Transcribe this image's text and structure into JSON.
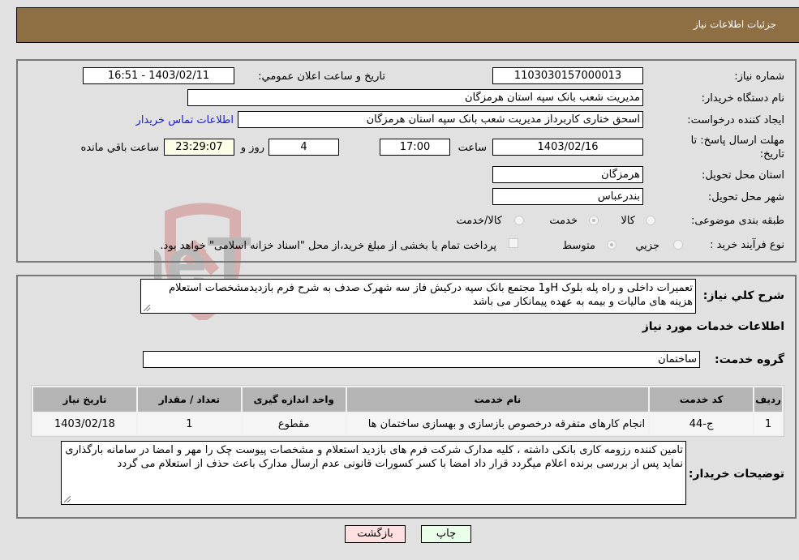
{
  "header": {
    "title": "جزئیات اطلاعات نیاز"
  },
  "form": {
    "need_number": {
      "label": "شماره نیاز:",
      "value": "1103030157000013"
    },
    "announce_datetime": {
      "label": "تاریخ و ساعت اعلان عمومي:",
      "value": "1403/02/11 - 16:51"
    },
    "buyer_org": {
      "label": "نام دستگاه خریدار:",
      "value": "مدیریت شعب بانک سپه استان هرمزگان"
    },
    "requester": {
      "label": "ایجاد کننده درخواست:",
      "value": "اسحق ختاری کاربرداز مدیریت شعب بانک سپه استان هرمزگان"
    },
    "buyer_contact_link": "اطلاعات تماس خریدار",
    "deadline": {
      "label_line1": "مهلت ارسال پاسخ: تا",
      "label_line2": "تاریخ:",
      "date": "1403/02/16",
      "time_label": "ساعت",
      "time": "17:00",
      "days": "4",
      "days_label": "روز و",
      "remaining": "23:29:07",
      "remaining_label": "ساعت باقي مانده"
    },
    "province": {
      "label": "استان محل تحویل:",
      "value": "هرمزگان"
    },
    "city": {
      "label": "شهر محل تحویل:",
      "value": "بندرعباس"
    },
    "category": {
      "label": "طبقه بندی موضوعی:",
      "options": [
        "کالا",
        "خدمت",
        "کالا/خدمت"
      ],
      "selected": "خدمت"
    },
    "purchase_type": {
      "label": "نوع فرآیند خرید :",
      "options": [
        "جزيي",
        "متوسط"
      ],
      "selected": "متوسط",
      "treasury_note": "پرداخت تمام یا بخشی از مبلغ خرید،از محل \"اسناد خزانه اسلامی\" خواهد بود."
    }
  },
  "description": {
    "label": "شرح كلي نياز:",
    "text": "تعمیرات داخلی و راه پله بلوک Hو1 مجتمع بانک سپه درکیش فاز سه شهرک صدف به شرح فرم بازدیدمشخصات استعلام هزینه های مالیات و بیمه به عهده پیمانکار می باشد"
  },
  "services_section": {
    "title": "اطلاعات خدمات مورد نیاز",
    "group_label": "گروه خدمت:",
    "group_value": "ساختمان"
  },
  "table": {
    "headers": [
      "ردیف",
      "کد خدمت",
      "نام خدمت",
      "واحد اندازه گیری",
      "تعداد / مقدار",
      "تاریخ نیاز"
    ],
    "rows": [
      [
        "1",
        "ج-44",
        "انجام کارهای متفرقه درخصوص بازسازی و بهسازی ساختمان ها",
        "مقطوع",
        "1",
        "1403/02/18"
      ]
    ]
  },
  "buyer_notes": {
    "label": "توضیحات خریدار:",
    "text": "تامین کننده رزومه کاری بانکی داشته ، کلیه مدارک شرکت فرم های بازدید استعلام  و مشخصات پیوست  چک را مهر و امضا در سامانه بارگذاری نماید پس از بررسی برنده اعلام میگردد  قرار داد امضا با کسر کسورات قانونی عدم ارسال مدارک باعث حذف از استعلام می گردد"
  },
  "buttons": {
    "print": "چاپ",
    "back": "بازگشت"
  },
  "colors": {
    "header_bg": "#8e6e43",
    "print_bg": "#eaffea",
    "back_bg": "#ffe0e0",
    "link": "#1a1acc"
  },
  "watermark": {
    "text": "AriaTender.neT"
  }
}
